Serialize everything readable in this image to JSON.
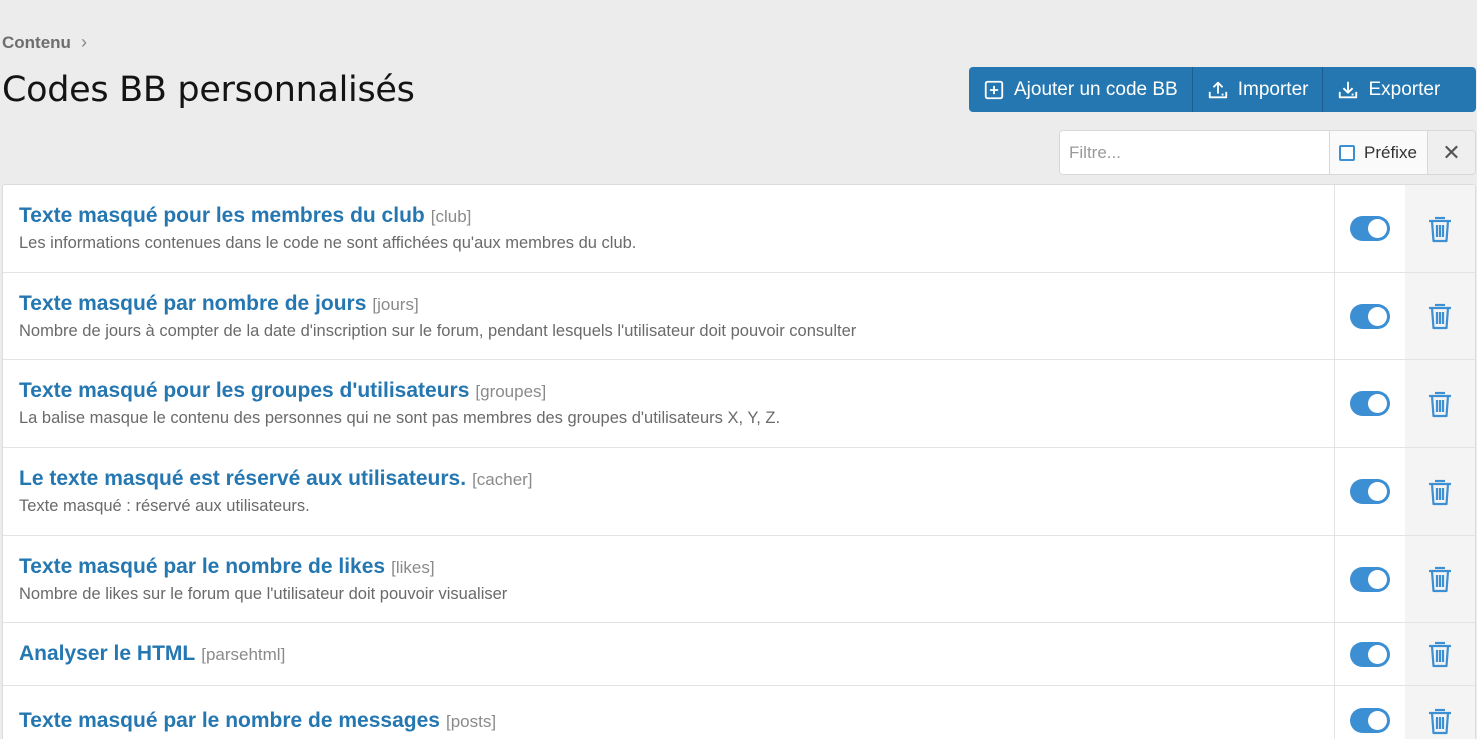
{
  "breadcrumb": {
    "label": "Contenu",
    "separator": "›"
  },
  "page": {
    "title": "Codes BB personnalisés"
  },
  "actions": {
    "add_label": "Ajouter un code BB",
    "import_label": "Importer",
    "export_label": "Exporter"
  },
  "filter": {
    "placeholder": "Filtre...",
    "value": "",
    "prefix_label": "Préfixe",
    "prefix_checked": false,
    "clear_symbol": "✕"
  },
  "colors": {
    "accent": "#2577b1",
    "toggle": "#3d8fd3",
    "background": "#ececec"
  },
  "rows": [
    {
      "title": "Texte masqué pour les membres du club",
      "tag": "[club]",
      "desc": "Les informations contenues dans le code ne sont affichées qu'aux membres du club.",
      "enabled": true
    },
    {
      "title": "Texte masqué par nombre de jours",
      "tag": "[jours]",
      "desc": "Nombre de jours à compter de la date d'inscription sur le forum, pendant lesquels l'utilisateur doit pouvoir consulter",
      "enabled": true
    },
    {
      "title": "Texte masqué pour les groupes d'utilisateurs",
      "tag": "[groupes]",
      "desc": "La balise masque le contenu des personnes qui ne sont pas membres des groupes d'utilisateurs X, Y, Z.",
      "enabled": true
    },
    {
      "title": "Le texte masqué est réservé aux utilisateurs.",
      "tag": "[cacher]",
      "desc": "Texte masqué : réservé aux utilisateurs.",
      "enabled": true
    },
    {
      "title": "Texte masqué par le nombre de likes",
      "tag": "[likes]",
      "desc": "Nombre de likes sur le forum que l'utilisateur doit pouvoir visualiser",
      "enabled": true
    },
    {
      "title": "Analyser le HTML",
      "tag": "[parsehtml]",
      "desc": "",
      "enabled": true
    },
    {
      "title": "Texte masqué par le nombre de messages",
      "tag": "[posts]",
      "desc": "",
      "enabled": true
    }
  ]
}
